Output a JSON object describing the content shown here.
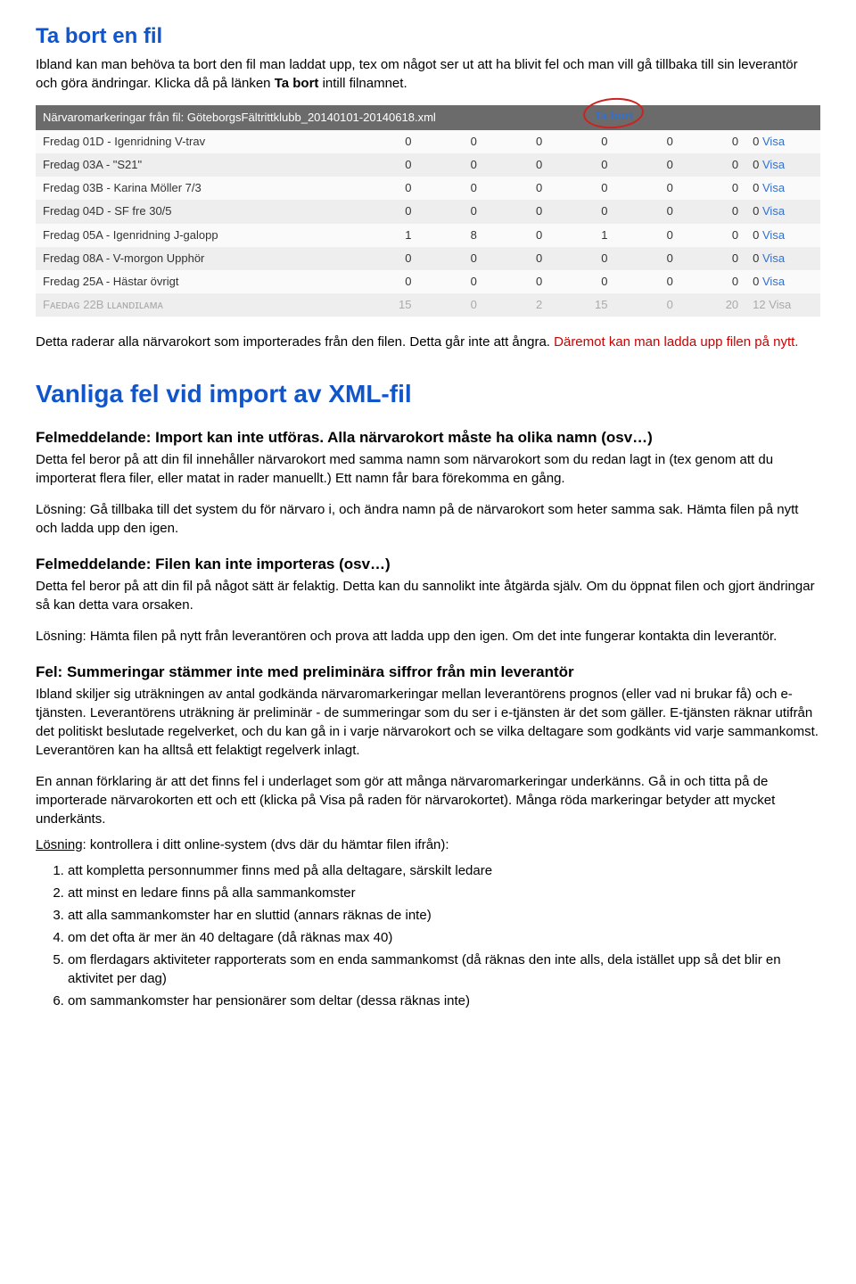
{
  "heading1": "Ta bort en fil",
  "para1": "Ibland kan man behöva ta bort den fil man laddat upp, tex om något ser ut att ha blivit fel och man vill gå tillbaka till sin leverantör och göra ändringar. Klicka då på länken ",
  "para1_boldlink": "Ta bort",
  "para1_tail": " intill filnamnet.",
  "table": {
    "header_label": "Närvaromarkeringar från fil: GöteborgsFältrittklubb_20140101-20140618.xml",
    "header_action": "Ta bort",
    "visa_label": "Visa",
    "rows": [
      {
        "name": "Fredag 01D - Igenridning V-trav",
        "c": [
          "0",
          "0",
          "0",
          "0",
          "0",
          "0",
          "0"
        ]
      },
      {
        "name": "Fredag 03A - \"S21\"",
        "c": [
          "0",
          "0",
          "0",
          "0",
          "0",
          "0",
          "0"
        ]
      },
      {
        "name": "Fredag 03B - Karina Möller 7/3",
        "c": [
          "0",
          "0",
          "0",
          "0",
          "0",
          "0",
          "0"
        ]
      },
      {
        "name": "Fredag 04D - SF fre 30/5",
        "c": [
          "0",
          "0",
          "0",
          "0",
          "0",
          "0",
          "0"
        ]
      },
      {
        "name": "Fredag 05A - Igenridning J-galopp",
        "c": [
          "1",
          "8",
          "0",
          "1",
          "0",
          "0",
          "0"
        ]
      },
      {
        "name": "Fredag 08A - V-morgon Upphör",
        "c": [
          "0",
          "0",
          "0",
          "0",
          "0",
          "0",
          "0"
        ]
      },
      {
        "name": "Fredag 25A - Hästar övrigt",
        "c": [
          "0",
          "0",
          "0",
          "0",
          "0",
          "0",
          "0"
        ]
      }
    ],
    "last_name": "Fᴀᴇᴅᴀɢ 22B   ʟʟᴀɴᴅɪʟᴀᴍᴀ",
    "last_cols": [
      "15",
      "0",
      "2",
      "15",
      "0",
      "20",
      "12"
    ]
  },
  "para2_a": "Detta raderar alla närvarokort som importerades från den filen. Detta går inte att ångra. ",
  "para2_red": "Däremot kan man ladda upp filen på nytt.",
  "heading2": "Vanliga fel vid import av XML-fil",
  "sub1": "Felmeddelande: Import kan inte utföras. Alla närvarokort måste ha olika namn (osv…)",
  "sub1_body": "Detta fel beror på att din fil innehåller närvarokort med samma namn som närvarokort som du redan lagt in (tex genom att du importerat flera filer, eller matat in rader manuellt.) Ett namn får bara förekomma en gång.",
  "sub1_sol": "Lösning: Gå tillbaka till det system du för närvaro i, och ändra namn på de närvarokort som heter samma sak. Hämta filen på nytt och ladda upp den igen.",
  "sub2": "Felmeddelande: Filen kan inte importeras (osv…)",
  "sub2_body": "Detta fel beror på att din fil på något sätt är felaktig. Detta kan du sannolikt inte åtgärda själv. Om du öppnat filen och gjort ändringar så kan detta vara orsaken.",
  "sub2_sol": "Lösning: Hämta filen på nytt från leverantören och prova att ladda upp den igen. Om det inte fungerar kontakta din leverantör.",
  "sub3": "Fel: Summeringar stämmer inte med preliminära siffror från min leverantör",
  "sub3_body": "Ibland skiljer sig uträkningen av antal godkända närvaromarkeringar mellan leverantörens prognos (eller vad ni brukar få) och e-tjänsten. Leverantörens uträkning är preliminär - de summeringar som du ser i e-tjänsten är det som gäller. E-tjänsten räknar utifrån det politiskt beslutade regelverket, och du kan gå in i varje närvarokort och se vilka deltagare som godkänts vid varje sammankomst. Leverantören kan ha alltså ett felaktigt regelverk inlagt.",
  "sub3_p2": "En annan förklaring är att det finns fel i underlaget som gör att många närvaromarkeringar underkänns. Gå in och titta på de importerade närvarokorten ett och ett (klicka på Visa på raden för närvarokortet). Många röda markeringar betyder att mycket underkänts.",
  "sub3_sol_lead": "Lösning",
  "sub3_sol_tail": ": kontrollera i ditt online-system (dvs där du hämtar filen ifrån):",
  "list": [
    "att kompletta personnummer finns med på alla deltagare, särskilt ledare",
    "att minst en ledare finns på alla sammankomster",
    "att alla sammankomster har en sluttid (annars räknas de inte)",
    "om det ofta är mer än 40 deltagare (då räknas max 40)",
    "om flerdagars aktiviteter rapporterats som en enda sammankomst (då räknas den inte alls, dela istället upp så det blir en aktivitet per dag)",
    "om sammankomster har pensionärer som deltar (dessa räknas inte)"
  ]
}
